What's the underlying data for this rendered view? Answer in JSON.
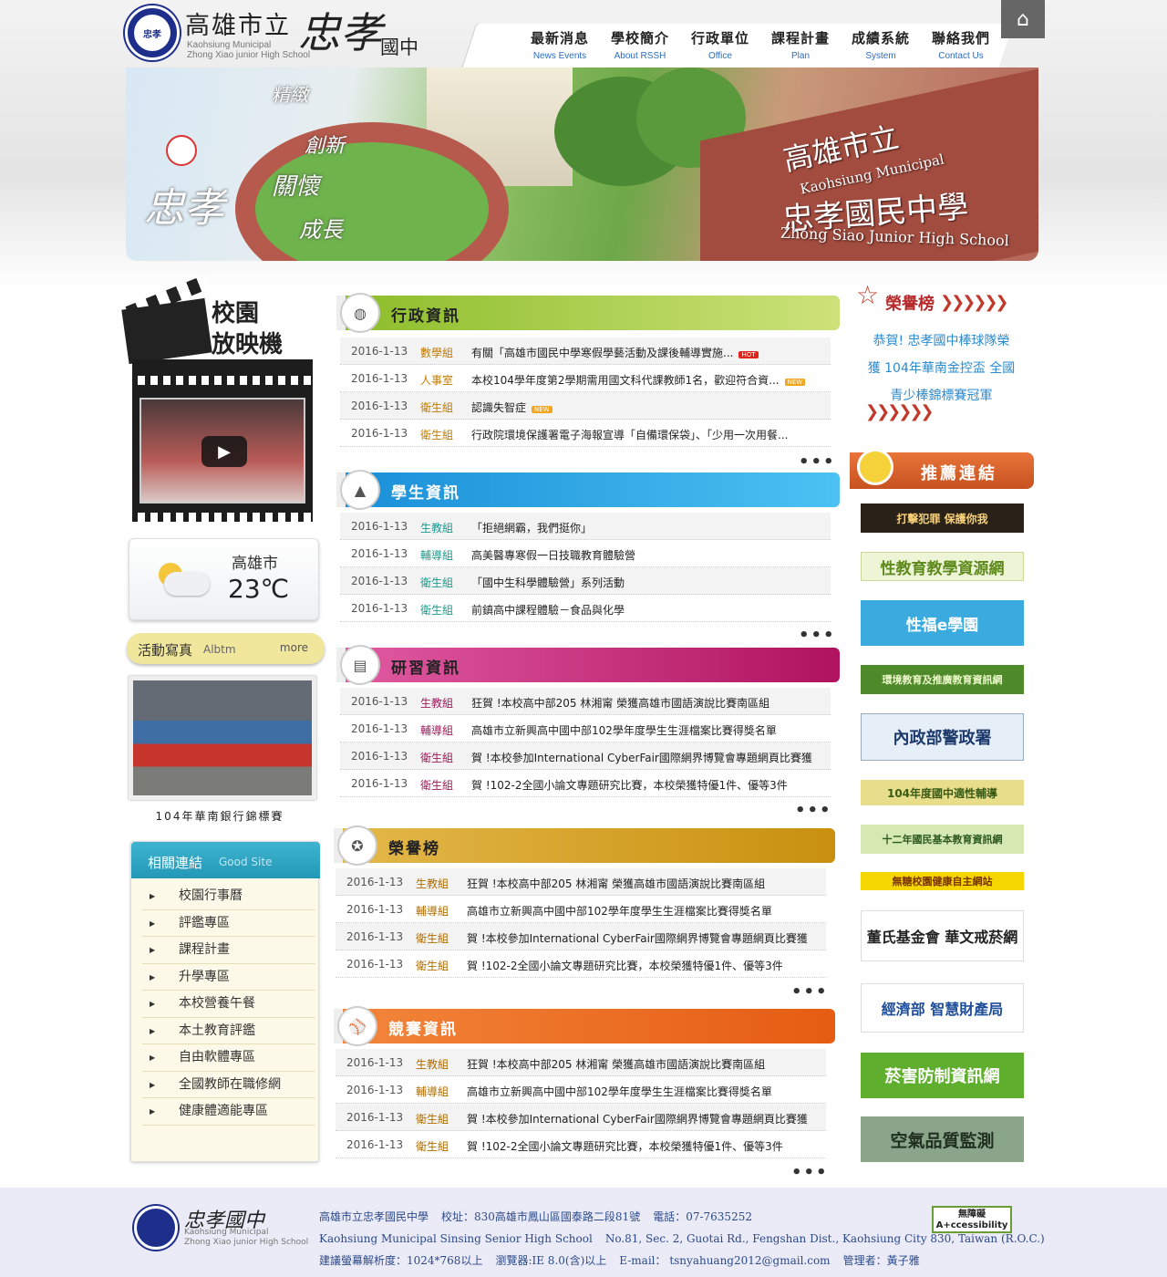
{
  "site": {
    "logo_seal": "忠孝",
    "logo_cn": "高雄市立",
    "logo_cn2": "忠孝",
    "logo_cn3": "國中",
    "logo_en1": "Kaohsiung Municipal",
    "logo_en2": "Zhong Xiao junior High School"
  },
  "nav": [
    {
      "cn": "最新消息",
      "en": "News Events"
    },
    {
      "cn": "學校簡介",
      "en": "About RSSH"
    },
    {
      "cn": "行政單位",
      "en": "Office"
    },
    {
      "cn": "課程計畫",
      "en": "Plan"
    },
    {
      "cn": "成績系統",
      "en": "System"
    },
    {
      "cn": "聯絡我們",
      "en": "Contact Us"
    }
  ],
  "banner": {
    "calli_main": "忠孝",
    "words": [
      "精緻",
      "創新",
      "關懷",
      "成長"
    ],
    "wall_cn1": "高雄市立",
    "wall_en1": "Kaohsiung Municipal",
    "wall_cn2": "忠孝國民中學",
    "wall_en2": "Zhong Siao Junior High School"
  },
  "left": {
    "clapper_line1": "校園",
    "clapper_line2": "放映機",
    "weather_city": "高雄市",
    "weather_temp": "23℃",
    "album_title": "活動寫真",
    "album_en": "Albtm",
    "album_more": "more",
    "album_caption": "104年華南銀行錦標賽",
    "links_title": "相關連結",
    "links_en": "Good Site",
    "links": [
      "校園行事曆",
      "評鑑專區",
      "課程計畫",
      "升學專區",
      "本校營養午餐",
      "本土教育評鑑",
      "自由軟體專區",
      "全國教師在職修網",
      "健康體適能專區"
    ]
  },
  "sections": {
    "admin": {
      "title": "行政資訊",
      "rows": [
        {
          "date": "2016-1-13",
          "unit": "數學組",
          "title": "有關「高雄市國民中學寒假學藝活動及課後輔導實施...",
          "badge": "HOT"
        },
        {
          "date": "2016-1-13",
          "unit": "人事室",
          "title": "本校104學年度第2學期需用國文科代課教師1名，歡迎符合資...",
          "badge": "NEW"
        },
        {
          "date": "2016-1-13",
          "unit": "衛生組",
          "title": "認識失智症",
          "badge": "NEW"
        },
        {
          "date": "2016-1-13",
          "unit": "衛生組",
          "title": "行政院環境保護署電子海報宣導「自備環保袋」、「少用一次用餐...",
          "badge": ""
        }
      ]
    },
    "student": {
      "title": "學生資訊",
      "rows": [
        {
          "date": "2016-1-13",
          "unit": "生教組",
          "title": "「拒絕網霸，我們挺你」",
          "badge": ""
        },
        {
          "date": "2016-1-13",
          "unit": "輔導組",
          "title": "高美醫專寒假一日技職教育體驗營",
          "badge": ""
        },
        {
          "date": "2016-1-13",
          "unit": "衛生組",
          "title": "「國中生科學體驗營」系列活動",
          "badge": ""
        },
        {
          "date": "2016-1-13",
          "unit": "衛生組",
          "title": "前鎮高中課程體驗－食品與化學",
          "badge": ""
        }
      ]
    },
    "study": {
      "title": "研習資訊",
      "rows": [
        {
          "date": "2016-1-13",
          "unit": "生教組",
          "title": "狂賀 !本校高中部205 林湘甯 榮獲高雄市國語演說比賽南區組",
          "badge": ""
        },
        {
          "date": "2016-1-13",
          "unit": "輔導組",
          "title": "高雄市立新興高中國中部102學年度學生生涯檔案比賽得獎名單",
          "badge": ""
        },
        {
          "date": "2016-1-13",
          "unit": "衛生組",
          "title": "賀 !本校參加International CyberFair國際網界博覽會專題網頁比賽獲",
          "badge": ""
        },
        {
          "date": "2016-1-13",
          "unit": "衛生組",
          "title": "賀 !102-2全國小論文專題研究比賽，本校榮獲特優1件、優等3件",
          "badge": ""
        }
      ]
    },
    "honor": {
      "title": "榮譽榜",
      "rows": [
        {
          "date": "2016-1-13",
          "unit": "生教組",
          "title": "狂賀 !本校高中部205 林湘甯 榮獲高雄市國語演說比賽南區組",
          "badge": ""
        },
        {
          "date": "2016-1-13",
          "unit": "輔導組",
          "title": "高雄市立新興高中國中部102學年度學生生涯檔案比賽得獎名單",
          "badge": ""
        },
        {
          "date": "2016-1-13",
          "unit": "衛生組",
          "title": "賀 !本校參加International CyberFair國際網界博覽會專題網頁比賽獲",
          "badge": ""
        },
        {
          "date": "2016-1-13",
          "unit": "衛生組",
          "title": "賀 !102-2全國小論文專題研究比賽，本校榮獲特優1件、優等3件",
          "badge": ""
        }
      ]
    },
    "contest": {
      "title": "競賽資訊",
      "rows": [
        {
          "date": "2016-1-13",
          "unit": "生教組",
          "title": "狂賀 !本校高中部205 林湘甯 榮獲高雄市國語演說比賽南區組",
          "badge": ""
        },
        {
          "date": "2016-1-13",
          "unit": "輔導組",
          "title": "高雄市立新興高中國中部102學年度學生生涯檔案比賽得獎名單",
          "badge": ""
        },
        {
          "date": "2016-1-13",
          "unit": "衛生組",
          "title": "賀 !本校參加International CyberFair國際網界博覽會專題網頁比賽獲",
          "badge": ""
        },
        {
          "date": "2016-1-13",
          "unit": "衛生組",
          "title": "賀 !102-2全國小論文專題研究比賽，本校榮獲特優1件、優等3件",
          "badge": ""
        }
      ]
    },
    "more": "•••"
  },
  "right": {
    "honor_head": "榮譽榜",
    "honor_lines": [
      "恭賀! 忠孝國中棒球隊榮",
      "獲 104年華南金控盃 全國",
      "青少棒錦標賽冠軍"
    ],
    "rec_title": "推薦連結",
    "banners": [
      "打擊犯罪 保護你我",
      "性教育教學資源網",
      "性福e學園",
      "環境教育及推廣教育資訊網",
      "內政部警政署",
      "104年度國中適性輔導",
      "十二年國民基本教育資訊網",
      "無糖校園健康自主網站",
      "董氏基金會 華文戒菸網",
      "經濟部 智慧財產局",
      "菸害防制資訊網",
      "空氣品質監測"
    ]
  },
  "footer": {
    "cn": "忠孝國中",
    "en1": "Kaohsiung Municipal",
    "en2": "Zhong Xiao junior High School",
    "school": "高雄市立忠孝國民中學",
    "address": "校址：830高雄市鳳山區國泰路二段81號",
    "phone": "電話：07-7635252",
    "en_name": "Kaohsiung Municipal Sinsing Senior High School",
    "en_addr": "No.81, Sec. 2, Guotai Rd., Fengshan Dist., Kaohsiung City 830, Taiwan (R.O.C.)",
    "resolution": "建議螢幕解析度：1024*768以上",
    "browser": "瀏覽器:IE 8.0(含)以上",
    "email": "E-mail： tsnyahuang2012@gmail.com",
    "admin": "管理者：黃子雅",
    "access1": "無障礙",
    "access2": "A+ccessibility"
  },
  "colors": {
    "admin": "#9cc832",
    "student": "#1ea2e6",
    "study": "#d83b8c",
    "honor": "#d9a41c",
    "contest": "#ec6a1d",
    "link_blue": "#2b6cc0"
  }
}
